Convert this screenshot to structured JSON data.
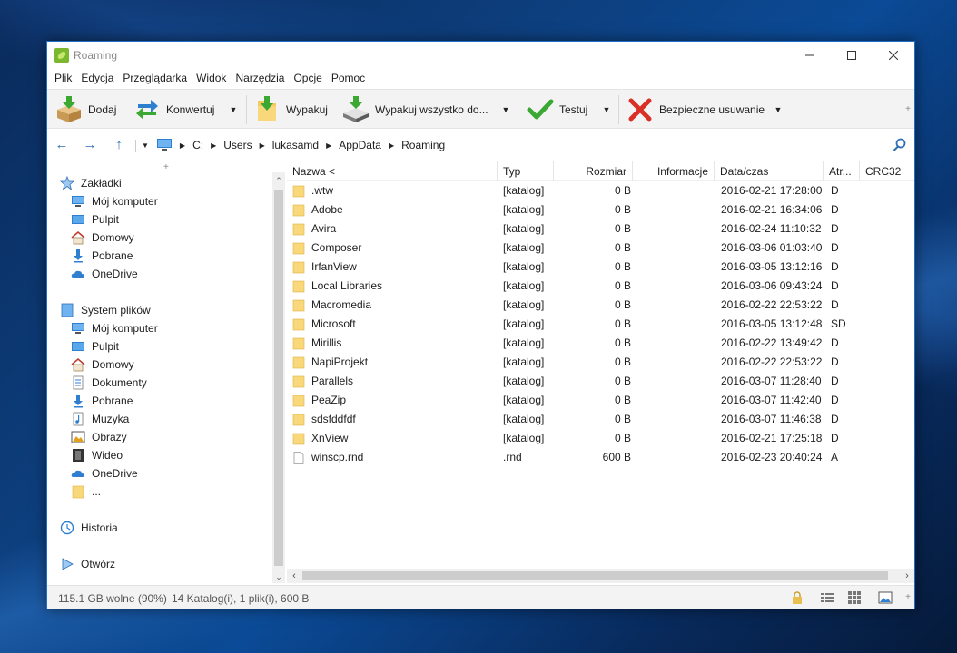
{
  "window": {
    "title": "Roaming"
  },
  "menu": [
    "Plik",
    "Edycja",
    "Przeglądarka",
    "Widok",
    "Narzędzia",
    "Opcje",
    "Pomoc"
  ],
  "toolbar": {
    "add": "Dodaj",
    "convert": "Konwertuj",
    "extract": "Wypakuj",
    "extract_all": "Wypakuj wszystko do...",
    "test": "Testuj",
    "secure_delete": "Bezpieczne usuwanie"
  },
  "address": {
    "crumbs": [
      "C:",
      "Users",
      "lukasamd",
      "AppData",
      "Roaming"
    ]
  },
  "sidebar": {
    "bookmarks": {
      "title": "Zakładki",
      "items": [
        "Mój komputer",
        "Pulpit",
        "Domowy",
        "Pobrane",
        "OneDrive"
      ]
    },
    "filesystem": {
      "title": "System plików",
      "items": [
        "Mój komputer",
        "Pulpit",
        "Domowy",
        "Dokumenty",
        "Pobrane",
        "Muzyka",
        "Obrazy",
        "Wideo",
        "OneDrive",
        "..."
      ]
    },
    "history": "Historia",
    "open": "Otwórz"
  },
  "columns": [
    "Nazwa <",
    "Typ",
    "Rozmiar",
    "Informacje",
    "Data/czas",
    "Atr...",
    "CRC32"
  ],
  "files": [
    {
      "name": ".wtw",
      "type": "[katalog]",
      "size": "0 B",
      "date": "2016-02-21 17:28:00",
      "attr": "D",
      "kind": "folder"
    },
    {
      "name": "Adobe",
      "type": "[katalog]",
      "size": "0 B",
      "date": "2016-02-21 16:34:06",
      "attr": "D",
      "kind": "folder"
    },
    {
      "name": "Avira",
      "type": "[katalog]",
      "size": "0 B",
      "date": "2016-02-24 11:10:32",
      "attr": "D",
      "kind": "folder"
    },
    {
      "name": "Composer",
      "type": "[katalog]",
      "size": "0 B",
      "date": "2016-03-06 01:03:40",
      "attr": "D",
      "kind": "folder"
    },
    {
      "name": "IrfanView",
      "type": "[katalog]",
      "size": "0 B",
      "date": "2016-03-05 13:12:16",
      "attr": "D",
      "kind": "folder"
    },
    {
      "name": "Local Libraries",
      "type": "[katalog]",
      "size": "0 B",
      "date": "2016-03-06 09:43:24",
      "attr": "D",
      "kind": "folder"
    },
    {
      "name": "Macromedia",
      "type": "[katalog]",
      "size": "0 B",
      "date": "2016-02-22 22:53:22",
      "attr": "D",
      "kind": "folder"
    },
    {
      "name": "Microsoft",
      "type": "[katalog]",
      "size": "0 B",
      "date": "2016-03-05 13:12:48",
      "attr": "SD",
      "kind": "folder"
    },
    {
      "name": "Mirillis",
      "type": "[katalog]",
      "size": "0 B",
      "date": "2016-02-22 13:49:42",
      "attr": "D",
      "kind": "folder"
    },
    {
      "name": "NapiProjekt",
      "type": "[katalog]",
      "size": "0 B",
      "date": "2016-02-22 22:53:22",
      "attr": "D",
      "kind": "folder"
    },
    {
      "name": "Parallels",
      "type": "[katalog]",
      "size": "0 B",
      "date": "2016-03-07 11:28:40",
      "attr": "D",
      "kind": "folder"
    },
    {
      "name": "PeaZip",
      "type": "[katalog]",
      "size": "0 B",
      "date": "2016-03-07 11:42:40",
      "attr": "D",
      "kind": "folder"
    },
    {
      "name": "sdsfddfdf",
      "type": "[katalog]",
      "size": "0 B",
      "date": "2016-03-07 11:46:38",
      "attr": "D",
      "kind": "folder"
    },
    {
      "name": "XnView",
      "type": "[katalog]",
      "size": "0 B",
      "date": "2016-02-21 17:25:18",
      "attr": "D",
      "kind": "folder"
    },
    {
      "name": "winscp.rnd",
      "type": ".rnd",
      "size": "600 B",
      "date": "2016-02-23 20:40:24",
      "attr": "A",
      "kind": "file"
    }
  ],
  "status": {
    "free": "115.1 GB wolne (90%)",
    "summary": "14 Katalog(i), 1 plik(i), 600 B"
  },
  "colors": {
    "accent": "#2f6fb6",
    "folder": "#f4c95d",
    "check": "#3aa833",
    "cross": "#d93025"
  }
}
